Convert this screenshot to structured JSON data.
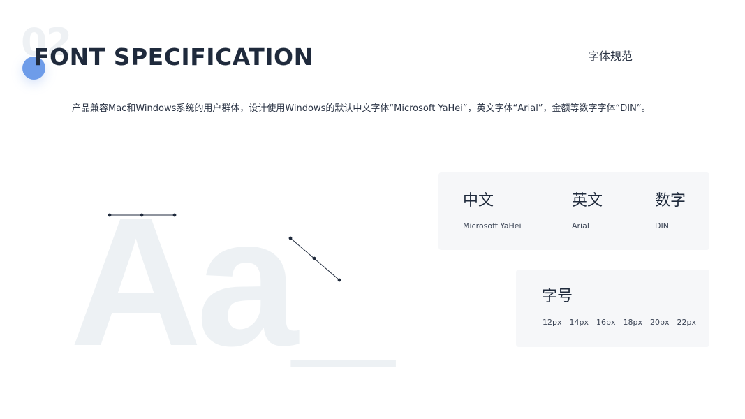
{
  "header": {
    "number": "02",
    "title": "FONT SPECIFICATION",
    "section_label": "字体规范"
  },
  "description": "产品兼容Mac和Windows系统的用户群体，设计使用Windows的默认中文字体“Microsoft YaHei”，英文字体“Arial”，金额等数字字体“DIN”。",
  "illustration": {
    "glyphs": "Aa_"
  },
  "font_card": {
    "columns": [
      {
        "title": "中文",
        "font": "Microsoft YaHei"
      },
      {
        "title": "英文",
        "font": "Arial"
      },
      {
        "title": "数字",
        "font": "DIN"
      }
    ]
  },
  "size_card": {
    "title": "字号",
    "sizes": [
      "12px",
      "14px",
      "16px",
      "18px",
      "20px",
      "22px"
    ]
  },
  "colors": {
    "title": "#1f2a3c",
    "accent": "#6e9ce9",
    "line": "#5d8fcd",
    "card_bg": "#f6f7f9",
    "glyph_fill": "#edf1f4"
  }
}
